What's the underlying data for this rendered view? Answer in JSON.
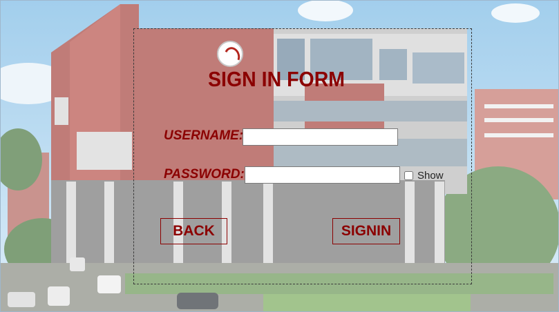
{
  "form": {
    "title": "SIGN IN FORM",
    "username_label": "USERNAME:",
    "password_label": "PASSWORD:",
    "username_value": "",
    "password_value": "",
    "show_label": "Show",
    "show_checked": false,
    "back_label": "BACK",
    "signin_label": "SIGNIN"
  },
  "colors": {
    "accent": "#8b0000",
    "sky": "#8ec3e8",
    "brick": "#a84a44"
  },
  "icons": {
    "logo": "college-logo-icon"
  }
}
